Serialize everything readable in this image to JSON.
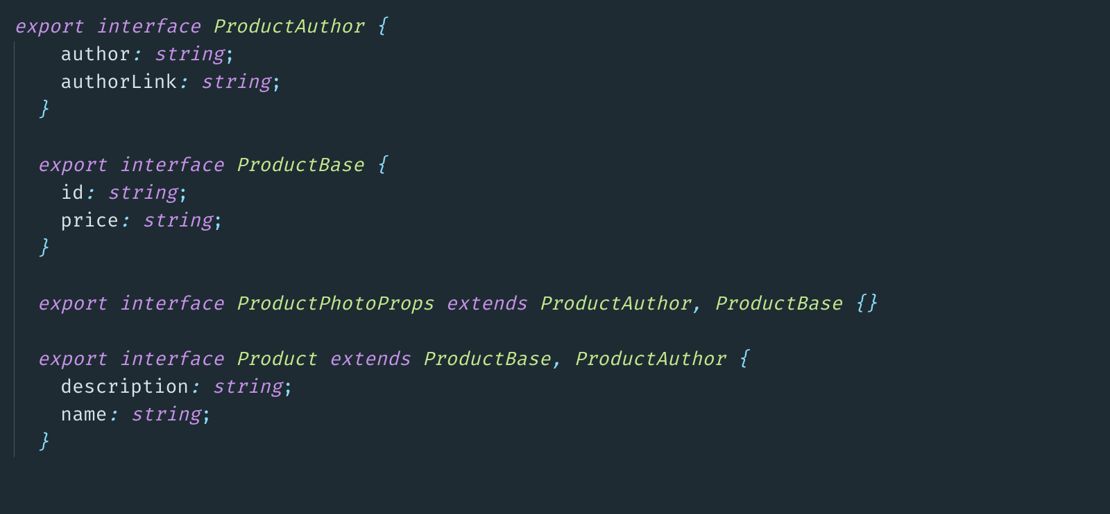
{
  "kw": {
    "export": "export",
    "interface": "interface",
    "extends": "extends"
  },
  "prim": {
    "string": "string"
  },
  "iface": {
    "ProductAuthor": {
      "name": "ProductAuthor",
      "body": [
        {
          "prop": "author",
          "type": "string"
        },
        {
          "prop": "authorLink",
          "type": "string"
        }
      ]
    },
    "ProductBase": {
      "name": "ProductBase",
      "body": [
        {
          "prop": "id",
          "type": "string"
        },
        {
          "prop": "price",
          "type": "string"
        }
      ]
    },
    "ProductPhotoProps": {
      "name": "ProductPhotoProps",
      "extends": [
        "ProductAuthor",
        "ProductBase"
      ],
      "body": []
    },
    "Product": {
      "name": "Product",
      "extends": [
        "ProductBase",
        "ProductAuthor"
      ],
      "body": [
        {
          "prop": "description",
          "type": "string"
        },
        {
          "prop": "name",
          "type": "string"
        }
      ]
    }
  },
  "tokens": {
    "lbrace": "{",
    "rbrace": "}",
    "colon": ":",
    "semi": ";",
    "comma": ",",
    "lbrace_rbrace": "{}"
  }
}
